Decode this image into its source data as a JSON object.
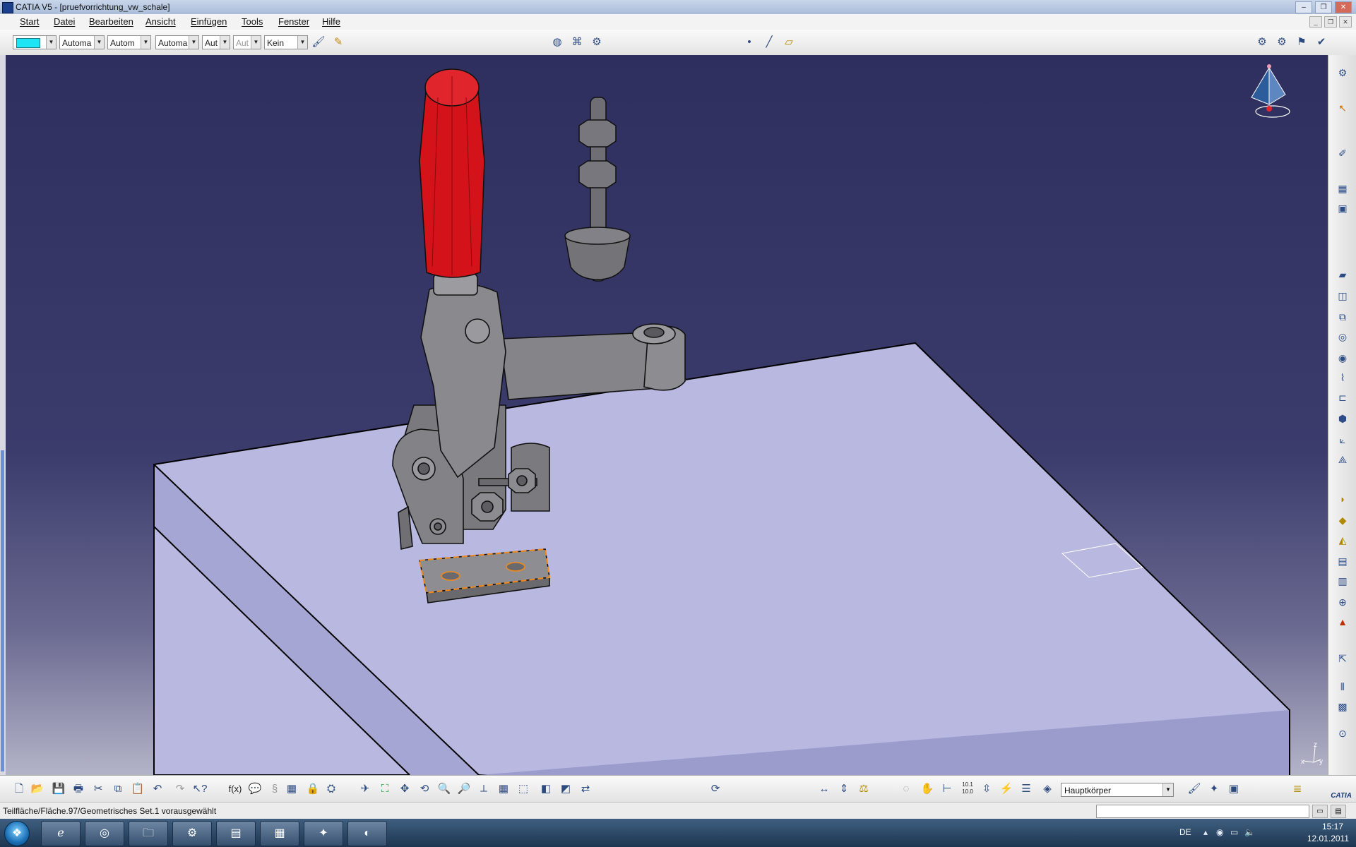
{
  "window": {
    "title": "CATIA V5 - [pruefvorrichtung_vw_schale]"
  },
  "menu": {
    "items": [
      "Start",
      "Datei",
      "Bearbeiten",
      "Ansicht",
      "Einfügen",
      "Tools",
      "Fenster",
      "Hilfe"
    ]
  },
  "toolbar_top": {
    "color_value": "",
    "linetype": "Automa",
    "thickness": "Autom",
    "point_style": "Automa",
    "layer": "Aut",
    "layer2": "Aut",
    "render_style": "Kein"
  },
  "part_body_selector": {
    "value": "Hauptkörper"
  },
  "status": {
    "message": "Teilfläche/Fläche.97/Geometrisches Set.1 vorausgewählt"
  },
  "compass_labels": {
    "x": "x",
    "y": "y",
    "z": "z"
  },
  "bottom_toolbar": {
    "fx_label": "f(x)",
    "measure_label": "10.1 10.0"
  },
  "taskbar": {
    "language": "DE",
    "time": "15:17",
    "date": "12.01.2011"
  },
  "brand": {
    "logo_text": "CATIA"
  },
  "colors": {
    "viewport_top": "#2f2f5f",
    "plate": "#b7b7e2",
    "handle": "#d4121a",
    "clamp": "#7a7a7a",
    "selection_highlight": "#f08a1c"
  }
}
